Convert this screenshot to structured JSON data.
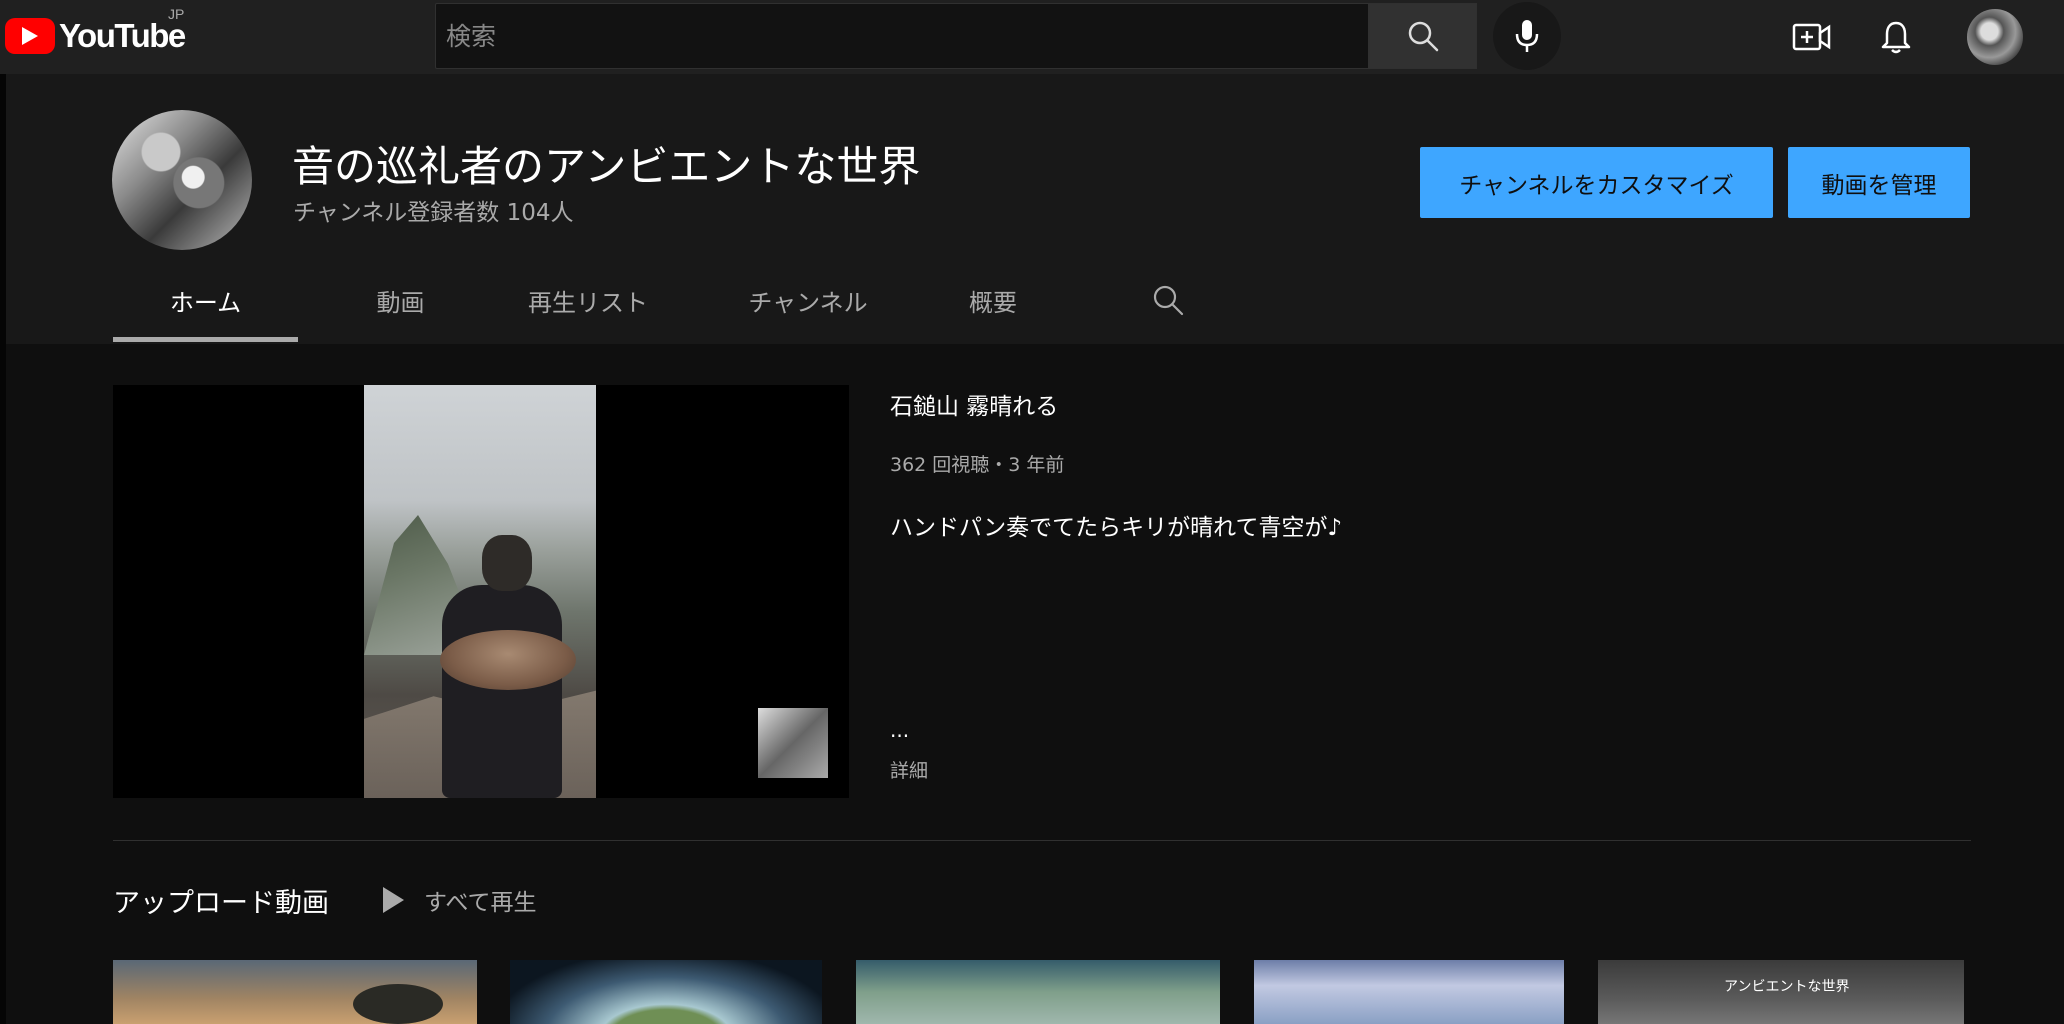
{
  "masthead": {
    "logo_text": "YouTube",
    "country_code": "JP",
    "search_placeholder": "検索",
    "icons": [
      "youtube-logo-icon",
      "search-icon",
      "microphone-icon",
      "create-video-icon",
      "bell-icon"
    ],
    "brand_color": "#ff0000"
  },
  "channel": {
    "name": "音の巡礼者のアンビエントな世界",
    "subscribers": "チャンネル登録者数 104人",
    "customize_label": "チャンネルをカスタマイズ",
    "manage_label": "動画を管理",
    "accent_color": "#3ea6ff"
  },
  "tabs": [
    {
      "label": "ホーム",
      "active": true
    },
    {
      "label": "動画",
      "active": false
    },
    {
      "label": "再生リスト",
      "active": false
    },
    {
      "label": "チャンネル",
      "active": false
    },
    {
      "label": "概要",
      "active": false
    }
  ],
  "featured": {
    "title": "石鎚山 霧晴れる",
    "meta": "362 回視聴・3 年前",
    "description": "ハンドパン奏でてたらキリが晴れて青空が♪",
    "ellipsis": "...",
    "more_label": "詳細"
  },
  "uploads": {
    "title": "アップロード動画",
    "play_all_label": "すべて再生",
    "thumbnails": [
      {
        "overlay_text": ""
      },
      {
        "overlay_text": ""
      },
      {
        "overlay_text": ""
      },
      {
        "overlay_text": ""
      },
      {
        "overlay_text": "アンビエントな世界"
      }
    ]
  }
}
